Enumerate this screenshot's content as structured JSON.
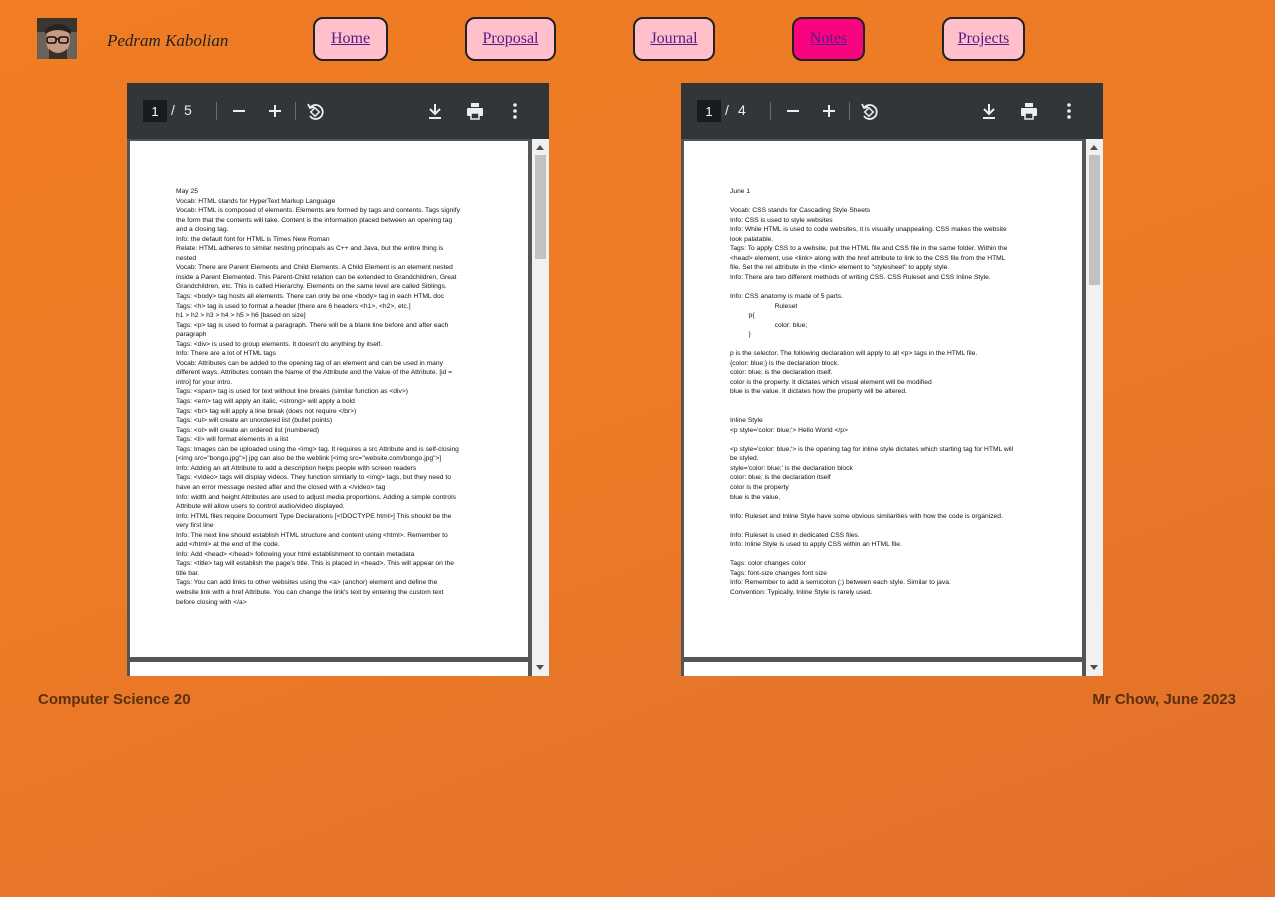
{
  "header": {
    "author_name": "Pedram Kabolian",
    "nav": [
      {
        "label": "Home",
        "active": false
      },
      {
        "label": "Proposal",
        "active": false
      },
      {
        "label": "Journal",
        "active": false
      },
      {
        "label": "Notes",
        "active": true
      },
      {
        "label": "Projects",
        "active": false
      }
    ]
  },
  "viewers": [
    {
      "current_page": "1",
      "separator": "/",
      "total_pages": "5",
      "icons": [
        "zoom-out-icon",
        "zoom-in-icon",
        "rotate-icon",
        "download-icon",
        "print-icon",
        "more-icon"
      ],
      "text": "May 25\nVocab: HTML stands for HyperText Markup Language\nVocab: HTML is composed of elements. Elements are formed by tags and contents. Tags signify\nthe form that the contents will take. Content is the information placed between an opening tag\nand a closing tag.\nInfo: the default font for HTML is Times New Roman\nRelate: HTML adheres to similar nesting principals as C++ and Java, but the entire thing is\nnested\nVocab: There are Parent Elements and Child Elements. A Child Element is an element nested\ninside a Parent Elemented. This Parent-Child relation can be extended to Grandchildren, Great\nGrandchildren, etc. This is called Hierarchy. Elements on the same level are called Siblings.\nTags: <body> tag hosts all elements. There can only be one <body> tag in each HTML doc\nTags: <h> tag is used to format a header [there are 6 headers <h1>, <h2>, etc.]\nh1 > h2 > h3 > h4 > h5 > h6 [based on size]\nTags: <p> tag is used to format a paragraph. There will be a blank line before and after each\nparagraph\nTags: <div> is used to group elements. It doesn't do anything by itself.\nInfo: There are a lot of HTML tags\nVocab: Attributes can be added to the opening tag of an element and can be used in many\ndifferent ways. Attributes contain the Name of the Attribute and the Value of the Attribute. [id =\nintro] for your intro.\nTags: <span> tag is used for text without line breaks (similar function as <div>)\nTags: <em> tag will apply an italic, <strong> will apply a bold\nTags: <br> tag will apply a line break (does not require </br>)\nTags: <ul> will create an unordered list (bullet points)\nTags: <ol> will create an ordered list (numbered)\nTags: <li> will format elements in a list\nTags: Images can be uploaded using the <img> tag. It requires a src Attribute and is self-closing\n[<img src=\"bongo.jpg\">] jpg can also be the weblink [<img src=\"website.com/bongo.jpg\">]\nInfo: Adding an alt Attribute to add a description helps people with screen readers\nTags: <video> tags will display videos. They function similarly to <img> tags, but they need to\nhave an error message nested after and the closed with a </video> tag\nInfo: width and height Attributes are used to adjust media proportions. Adding a simple controls\nAttribute will allow users to control audio/video displayed.\nInfo: HTML files require Document Type Declarations [<!DOCTYPE html>] This should be the\nvery first line\nInfo: The next line should establish HTML structure and content using <html>. Remember to\nadd </html> at the end of the code.\nInfo: Add <head> </head> following your html establishment to contain metadata\nTags: <title> tag will establish the page's title. This is placed in <head>. This will appear on the\ntitle bar.\nTags: You can add links to other websites using the <a> (anchor) element and define the\nwebsite link with a href Attribute. You can change the link's text by entering the custom text\nbefore closing with </a>"
    },
    {
      "current_page": "1",
      "separator": "/",
      "total_pages": "4",
      "icons": [
        "zoom-out-icon",
        "zoom-in-icon",
        "rotate-icon",
        "download-icon",
        "print-icon",
        "more-icon"
      ],
      "text": "June 1\n\nVocab: CSS stands for Cascading Style Sheets\nInfo: CSS is used to style websites\nInfo: While HTML is used to code websites, it is visually unappealing. CSS makes the website\nlook palatable.\nTags: To apply CSS to a website, put the HTML file and CSS file in the same folder. Within the\n<head> element, use <link> along with the href attribute to link to the CSS file from the HTML\nfile. Set the rel attribute in the <link> element to \"stylesheet\" to apply style.\nInfo: There are two different methods of writing CSS. CSS Ruleset and CSS Inline Style.\n\nInfo: CSS anatomy is made of 5 parts.\n                        Ruleset\n          p{\n                        color: blue;\n          }\n\np is the selector. The following declaration will apply to all <p> tags in the HTML file.\n{color: blue;} is the declaration block.\ncolor: blue; is the declaration itself.\ncolor is the property. It dictates which visual element will be modified\nblue is the value. It dictates how the property will be altered.\n\n\nInline Style\n<p style='color: blue;'> Hello World </p>\n\n<p style='color: blue;'> is the opening tag for inline style dictates which starting tag for HTML will\nbe styled.\nstyle='color: blue;' is the declaration block\ncolor: blue; is the declaration itself\ncolor is the property\nblue is the value.\n\nInfo: Ruleset and Inline Style have some obvious similarities with how the code is organized.\n\nInfo: Ruleset is used in dedicated CSS files.\nInfo: Inline Style is used to apply CSS within an HTML file.\n\nTags: color changes color\nTags: font-size changes font size\nInfo: Remember to add a semicolon (;) between each style. Similar to java.\nConvention: Typically, Inline Style is rarely used."
    }
  ],
  "footer": {
    "left": "Computer Science 20",
    "right": "Mr Chow, June 2023"
  },
  "colors": {
    "background": "#ef7b25",
    "nav_button": "#ffc0cb",
    "nav_active": "#f7047e",
    "nav_link": "#551a8b",
    "footer_text": "#5a3010"
  }
}
